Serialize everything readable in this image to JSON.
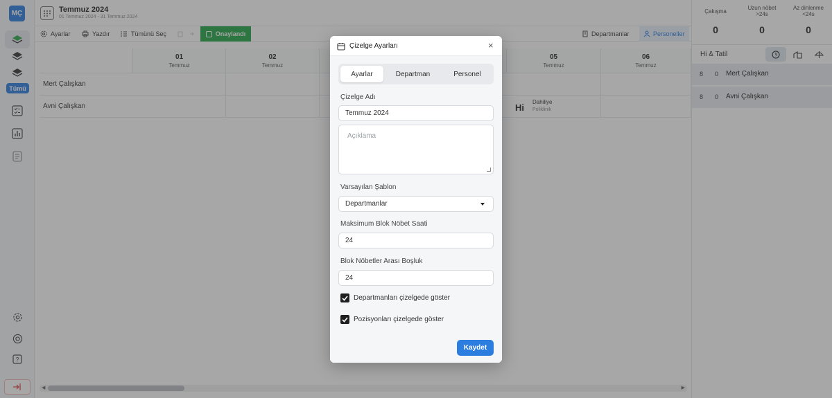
{
  "sidebar": {
    "avatar": "MÇ",
    "filter_all": "Tümü"
  },
  "header": {
    "title": "Temmuz 2024",
    "subtitle": "01 Temmuz 2024 - 31 Temmuz 2024"
  },
  "toolbar": {
    "settings": "Ayarlar",
    "print": "Yazdır",
    "select_all": "Tümünü Seç",
    "approved": "Onaylandı",
    "departments": "Departmanlar",
    "staff": "Personeller"
  },
  "grid": {
    "days": [
      {
        "day": "01",
        "month": "Temmuz"
      },
      {
        "day": "02",
        "month": "Temmuz"
      },
      {
        "day": "05",
        "month": "Temmuz"
      },
      {
        "day": "06",
        "month": "Temmuz"
      }
    ],
    "rows": [
      "Mert Çalışkan",
      "Avni Çalışkan"
    ],
    "shift": {
      "code": "Hi",
      "department": "Dahiliye",
      "position": "Poliklinik"
    }
  },
  "stats": {
    "conflict_label": "Çakışma",
    "conflict_value": "0",
    "long_label": "Uzun nöbet",
    "long_sub": ">24s",
    "long_value": "0",
    "rest_label": "Az dinlenme",
    "rest_sub": "<24s",
    "rest_value": "0"
  },
  "right_panel": {
    "tab_label": "Hi & Tatil",
    "people": [
      {
        "a": "8",
        "b": "0",
        "name": "Mert Çalışkan"
      },
      {
        "a": "8",
        "b": "0",
        "name": "Avni Çalışkan"
      }
    ]
  },
  "modal": {
    "title": "Çizelge Ayarları",
    "close": "×",
    "tabs": [
      "Ayarlar",
      "Departman",
      "Personel"
    ],
    "name_label": "Çizelge Adı",
    "name_value": "Temmuz 2024",
    "desc_placeholder": "Açıklama",
    "template_label": "Varsayılan Şablon",
    "template_value": "Departmanlar",
    "max_block_label": "Maksimum Blok Nöbet Saati",
    "max_block_value": "24",
    "gap_label": "Blok Nöbetler Arası Boşluk",
    "gap_value": "24",
    "show_departments": "Departmanları çizelgede göster",
    "show_positions": "Pozisyonları çizelgede göster",
    "save": "Kaydet"
  },
  "colors": {
    "accent": "#2b7de0",
    "approved": "#22a545"
  }
}
